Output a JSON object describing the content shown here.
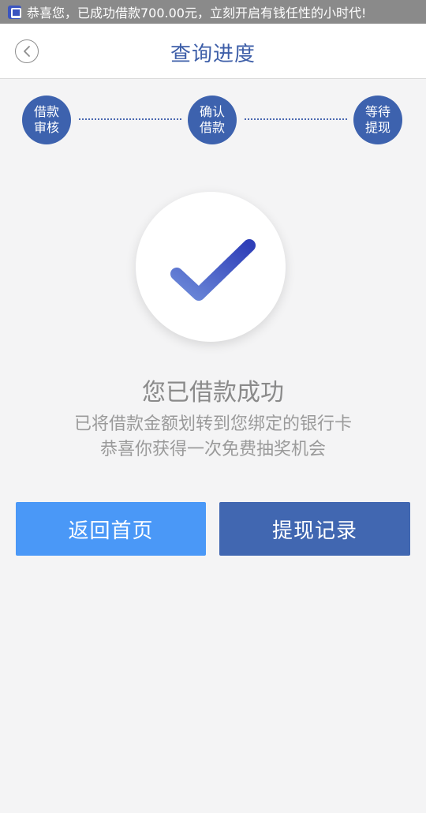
{
  "notification": {
    "text": "恭喜您，已成功借款700.00元，立刻开启有钱任性的小时代!",
    "icon": "app-logo-icon"
  },
  "header": {
    "title": "查询进度",
    "back_icon": "chevron-left-icon"
  },
  "steps": [
    {
      "line1": "借款",
      "line2": "审核"
    },
    {
      "line1": "确认",
      "line2": "借款"
    },
    {
      "line1": "等待",
      "line2": "提现"
    }
  ],
  "result": {
    "icon": "check-icon",
    "title": "您已借款成功",
    "message_line1": "已将借款金额划转到您绑定的银行卡",
    "message_line2": "恭喜你获得一次免费抽奖机会"
  },
  "buttons": {
    "home_label": "返回首页",
    "records_label": "提现记录"
  },
  "colors": {
    "primary": "#3d62ae",
    "home_button": "#4a98f7",
    "records_button": "#4167b1"
  }
}
